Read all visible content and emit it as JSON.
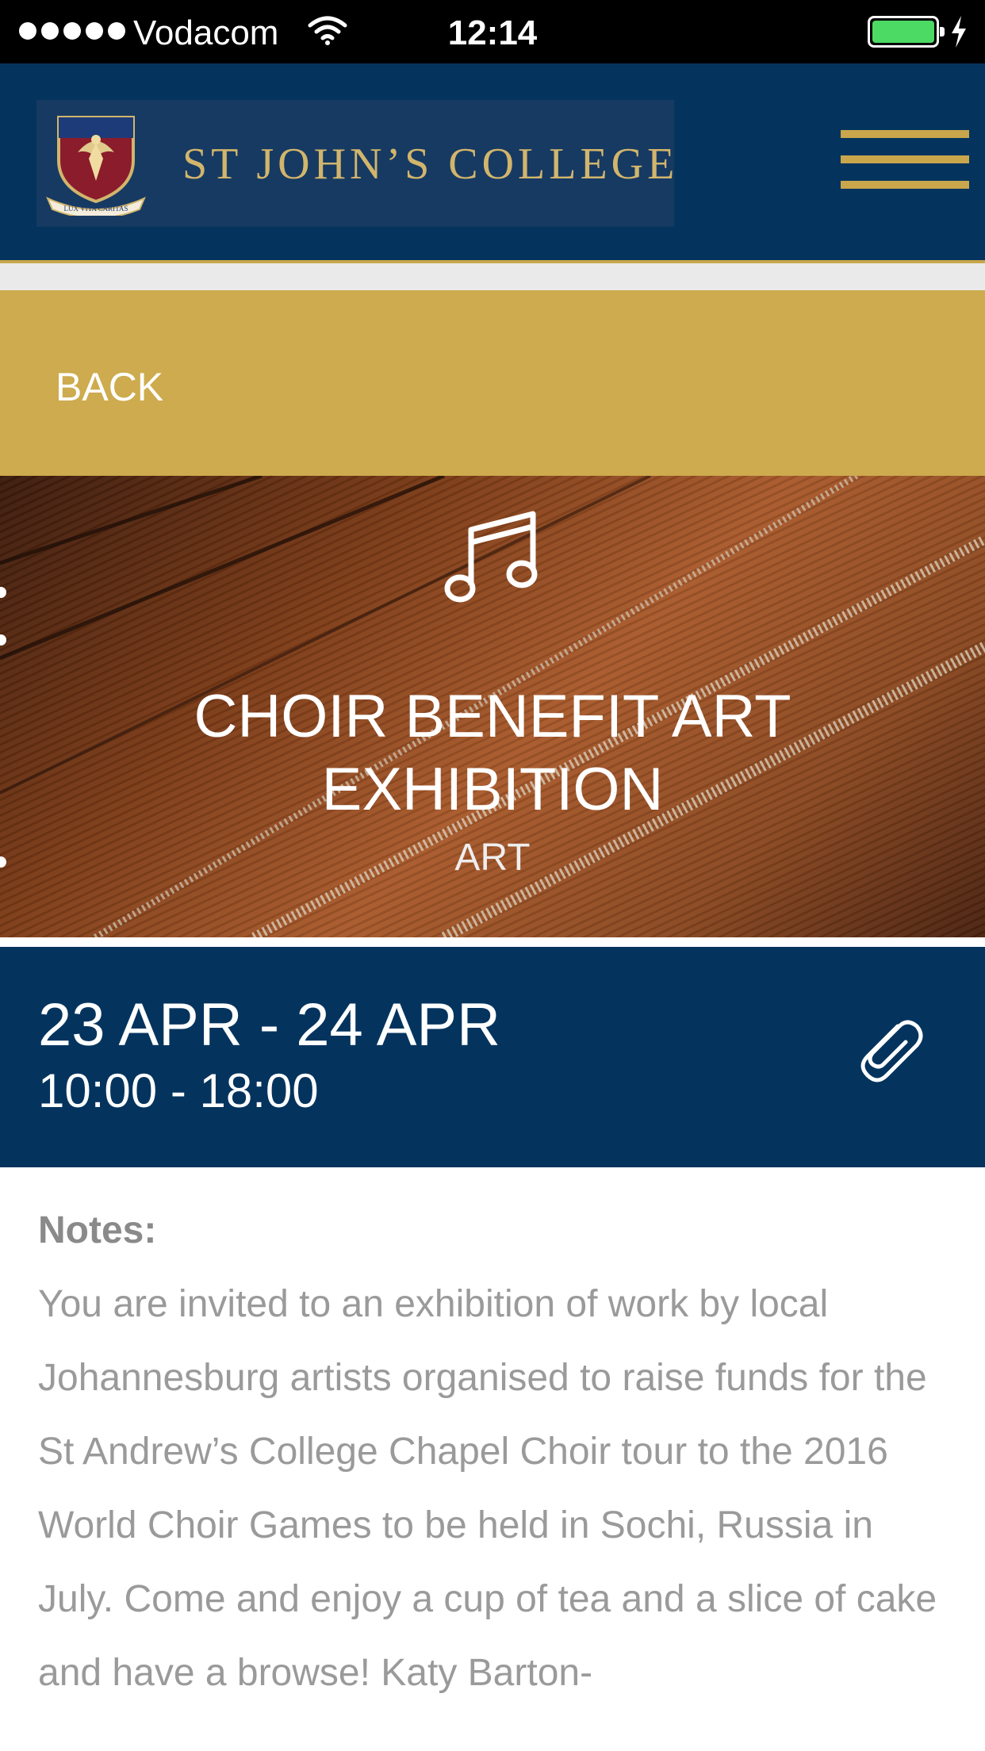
{
  "status_bar": {
    "carrier": "Vodacom",
    "time": "12:14",
    "battery_color": "#4cd964"
  },
  "header": {
    "college_name": "ST JOHN’S COLLEGE",
    "crest_motto": "LUX VITA CARITAS",
    "menu_icon": "hamburger-icon",
    "background": "#04345e",
    "accent": "#c9a64c"
  },
  "back_bar": {
    "label": "BACK",
    "background": "#cdab4e"
  },
  "event": {
    "icon": "music-notes-icon",
    "title": "CHOIR BENEFIT ART EXHIBITION",
    "category": "ART",
    "date_range": "23 APR - 24 APR",
    "time_range": "10:00 - 18:00",
    "attachment_icon": "paperclip-icon"
  },
  "notes": {
    "label": "Notes:",
    "body": "You are invited to an exhibition of work by local Johannesburg artists organised to raise funds for the St Andrew’s College Chapel Choir tour to the 2016 World Choir Games to be held in Sochi, Russia in July. Come and enjoy a cup of tea and a slice of cake and have a browse! Katy Barton-"
  }
}
